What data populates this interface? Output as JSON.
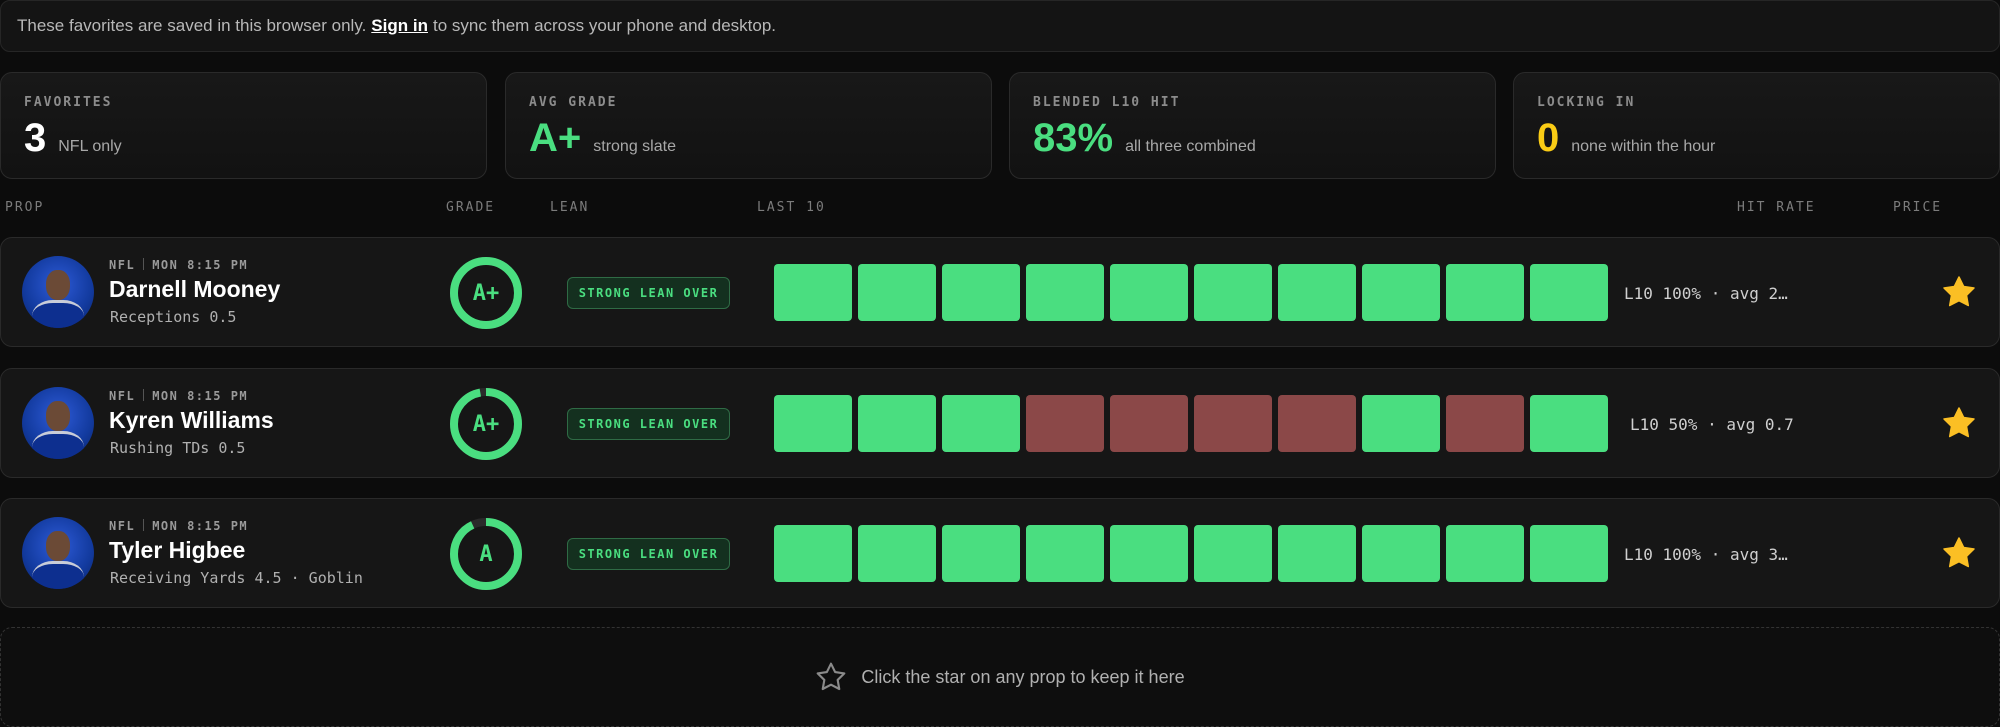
{
  "banner": {
    "text_before": "These favorites are saved in this browser only.",
    "link": "Sign in",
    "text_after": "to sync them across your phone and desktop."
  },
  "stats": [
    {
      "label": "FAVORITES",
      "value": "3",
      "sub": "NFL only",
      "color": "#ffffff"
    },
    {
      "label": "AVG GRADE",
      "value": "A+",
      "sub": "strong slate",
      "color": "#4ade80"
    },
    {
      "label": "BLENDED L10 HIT",
      "value": "83%",
      "sub": "all three combined",
      "color": "#4ade80"
    },
    {
      "label": "LOCKING IN",
      "value": "0",
      "sub": "none within the hour",
      "color": "#facc15"
    }
  ],
  "columns": {
    "prop": "PROP",
    "grade": "GRADE",
    "lean": "LEAN",
    "last10": "LAST 10",
    "hit_rate": "HIT RATE",
    "price": "PRICE"
  },
  "props": [
    {
      "league": "NFL",
      "time": "MON 8:15 PM",
      "player": "Darnell Mooney",
      "line": "Receptions 0.5",
      "grade": "A+",
      "grade_fill": 1.0,
      "lean": "STRONG LEAN OVER",
      "last10": [
        1,
        1,
        1,
        1,
        1,
        1,
        1,
        1,
        1,
        1
      ],
      "hit_rate": "L10 100% · avg 2…",
      "favorited": true
    },
    {
      "league": "NFL",
      "time": "MON 8:15 PM",
      "player": "Kyren Williams",
      "line": "Rushing TDs 0.5",
      "grade": "A+",
      "grade_fill": 0.97,
      "lean": "STRONG LEAN OVER",
      "last10": [
        1,
        1,
        1,
        0,
        0,
        0,
        0,
        1,
        0,
        1
      ],
      "hit_rate": "L10 50% · avg 0.7",
      "favorited": true
    },
    {
      "league": "NFL",
      "time": "MON 8:15 PM",
      "player": "Tyler Higbee",
      "line": "Receiving Yards 4.5 · Goblin",
      "grade": "A",
      "grade_fill": 0.93,
      "lean": "STRONG LEAN OVER",
      "last10": [
        1,
        1,
        1,
        1,
        1,
        1,
        1,
        1,
        1,
        1
      ],
      "hit_rate": "L10 100% · avg 3…",
      "favorited": true
    }
  ],
  "empty_prompt": "Click the star on any prop to keep it here",
  "colors": {
    "hit": "#4ade80",
    "miss": "#8b4848",
    "star": "#fbbf24",
    "accent": "#4ade80"
  }
}
